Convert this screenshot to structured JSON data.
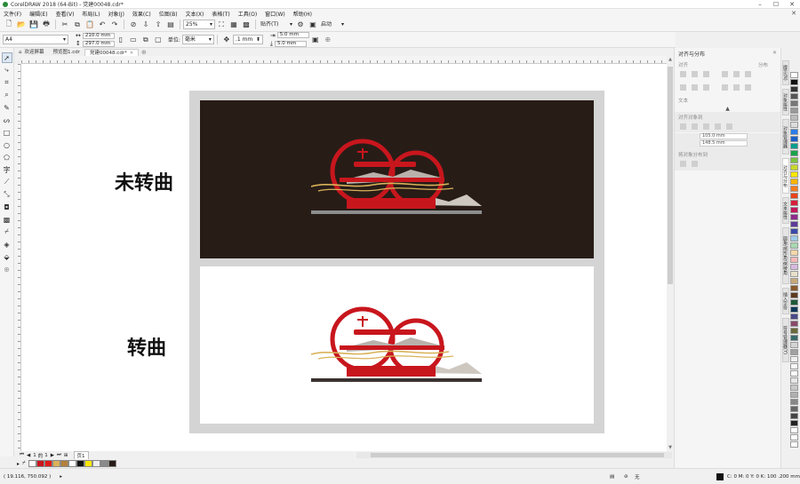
{
  "window": {
    "title": "CorelDRAW 2018 (64-Bit) - 党建00048.cdr*",
    "controls": [
      "–",
      "☐",
      "✕"
    ]
  },
  "menu": [
    "文件(F)",
    "编辑(E)",
    "查看(V)",
    "布局(L)",
    "对象(J)",
    "效果(C)",
    "位图(B)",
    "文本(X)",
    "表格(T)",
    "工具(O)",
    "窗口(W)",
    "帮助(H)"
  ],
  "toolbar": {
    "zoom": "25%",
    "snap": "贴齐(T)",
    "launch": "启动"
  },
  "propbar": {
    "page_size": "A4",
    "width": "210.0 mm",
    "height": "297.0 mm",
    "units_label": "单位:",
    "units": "毫米",
    "nudge": ".1 mm",
    "dup_x": "5.0 mm",
    "dup_y": "5.0 mm"
  },
  "tabs": [
    {
      "label": "欢迎屏幕",
      "active": false
    },
    {
      "label": "预览图1.cdr",
      "active": false
    },
    {
      "label": "党建00048.cdr*",
      "active": true
    }
  ],
  "artwork": {
    "label_unconverted": "未转曲",
    "label_converted": "转曲"
  },
  "page_nav": {
    "current": "1",
    "of": "的",
    "total": "1",
    "page_tab": "页1"
  },
  "status": {
    "coords": "( 19.116, 750.092 )",
    "color_info": "C: 0 M: 0 Y: 0 K: 100  .200 mm",
    "fill_none": "无"
  },
  "docker": {
    "title": "对齐与分布",
    "section_align": "对齐",
    "section_distribute": "分布",
    "section_text": "文本",
    "section_object_spacing": "对齐对象到",
    "field_x": "105.0 mm",
    "field_y": "148.5 mm",
    "section_grid": "将对象分布到"
  },
  "right_tabs": [
    "提示(N)",
    "对象属性",
    "对象管理器",
    "对齐与分布",
    "文本属性",
    "圆角/扇形角/倒棱角",
    "插入字符",
    "符号管理器(Y)"
  ],
  "colors": {
    "dark_panel": "#281c17",
    "accent_red": "#c8161d",
    "gold": "#d9b25a"
  }
}
